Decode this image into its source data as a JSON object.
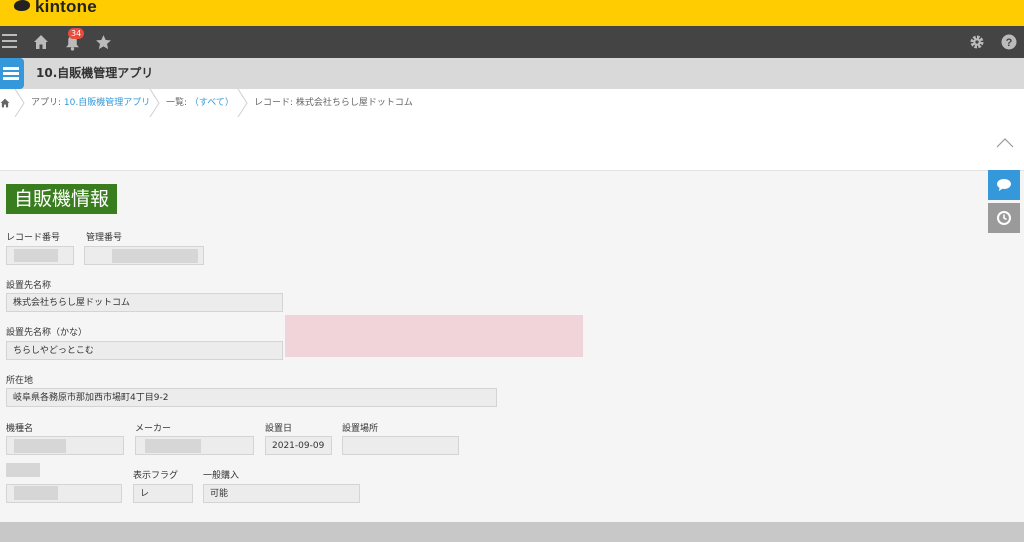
{
  "header": {
    "brand": "kintone"
  },
  "nav": {
    "notification_count": "34"
  },
  "app": {
    "title": "10.自販機管理アプリ"
  },
  "breadcrumb": {
    "app_prefix": "アプリ: ",
    "app_link": "10.自販機管理アプリ",
    "list_prefix": "一覧: ",
    "list_link": "（すべて）",
    "record": "レコード: 株式会社ちらし屋ドットコム"
  },
  "section": {
    "title": "自販機情報"
  },
  "fields": {
    "record_no": {
      "label": "レコード番号",
      "value": ""
    },
    "mgmt_no": {
      "label": "管理番号",
      "value": ""
    },
    "site_name": {
      "label": "設置先名称",
      "value": "株式会社ちらし屋ドットコム"
    },
    "site_kana": {
      "label": "設置先名称（かな）",
      "value": "ちらしやどっとこむ"
    },
    "address": {
      "label": "所在地",
      "value": "岐阜県各務原市那加西市場町4丁目9-2"
    },
    "model": {
      "label": "機種名",
      "value": ""
    },
    "maker": {
      "label": "メーカー",
      "value": ""
    },
    "install_date": {
      "label": "設置日",
      "value": "2021-09-09"
    },
    "install_place": {
      "label": "設置場所",
      "value": ""
    },
    "display_flag": {
      "label": "表示フラグ",
      "value": "レ"
    },
    "general_purchase": {
      "label": "一般購入",
      "value": "可能"
    }
  },
  "colors": {
    "header": "#fecc00",
    "nav": "#444444",
    "section": "#3a7d1e",
    "accent": "#3498db"
  }
}
